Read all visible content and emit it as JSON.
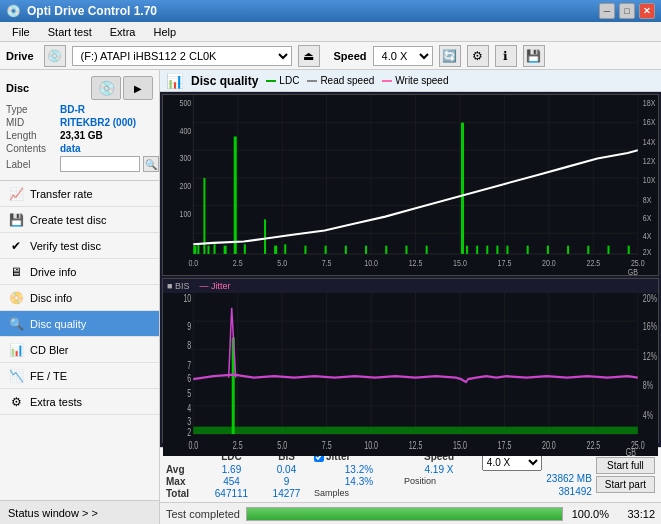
{
  "app": {
    "title": "Opti Drive Control 1.70",
    "icon": "💿"
  },
  "titlebar": {
    "minimize_label": "─",
    "maximize_label": "□",
    "close_label": "✕"
  },
  "menu": {
    "items": [
      "File",
      "Start test",
      "Extra",
      "Help"
    ]
  },
  "drive": {
    "label": "Drive",
    "select_value": "(F:)  ATAPI iHBS112  2 CL0K",
    "speed_label": "Speed",
    "speed_value": "4.0 X"
  },
  "disc": {
    "section_label": "Disc",
    "type_label": "Type",
    "type_value": "BD-R",
    "mid_label": "MID",
    "mid_value": "RITEKBR2 (000)",
    "length_label": "Length",
    "length_value": "23,31 GB",
    "contents_label": "Contents",
    "contents_value": "data",
    "label_label": "Label",
    "label_placeholder": ""
  },
  "nav": {
    "items": [
      {
        "id": "transfer-rate",
        "label": "Transfer rate",
        "icon": "📈"
      },
      {
        "id": "create-test-disc",
        "label": "Create test disc",
        "icon": "💾"
      },
      {
        "id": "verify-test-disc",
        "label": "Verify test disc",
        "icon": "✔"
      },
      {
        "id": "drive-info",
        "label": "Drive info",
        "icon": "🖥"
      },
      {
        "id": "disc-info",
        "label": "Disc info",
        "icon": "📀"
      },
      {
        "id": "disc-quality",
        "label": "Disc quality",
        "icon": "🔍",
        "active": true
      },
      {
        "id": "cd-bler",
        "label": "CD Bler",
        "icon": "📊"
      },
      {
        "id": "fe-te",
        "label": "FE / TE",
        "icon": "📉"
      },
      {
        "id": "extra-tests",
        "label": "Extra tests",
        "icon": "⚙"
      }
    ]
  },
  "status_window": {
    "label": "Status window > >"
  },
  "chart": {
    "title": "Disc quality",
    "legend": {
      "ldc_label": "LDC",
      "read_label": "Read speed",
      "write_label": "Write speed",
      "bis_label": "BIS",
      "jitter_label": "Jitter"
    },
    "top_chart": {
      "y_max": 500,
      "x_max": 25,
      "y_right_labels": [
        "18X",
        "16X",
        "14X",
        "12X",
        "10X",
        "8X",
        "6X",
        "4X",
        "2X"
      ],
      "x_labels": [
        "0.0",
        "2.5",
        "5.0",
        "7.5",
        "10.0",
        "12.5",
        "15.0",
        "17.5",
        "20.0",
        "22.5",
        "25.0"
      ]
    },
    "bottom_chart": {
      "y_max": 10,
      "x_max": 25,
      "y_right_labels": [
        "20%",
        "16%",
        "12%",
        "8%",
        "4%"
      ],
      "x_labels": [
        "0.0",
        "2.5",
        "5.0",
        "7.5",
        "10.0",
        "12.5",
        "15.0",
        "17.5",
        "20.0",
        "22.5",
        "25.0"
      ]
    }
  },
  "stats": {
    "headers": [
      "",
      "LDC",
      "BIS",
      "",
      "Jitter",
      "Speed",
      ""
    ],
    "rows": [
      {
        "label": "Avg",
        "ldc": "1.69",
        "bis": "0.04",
        "jitter": "13.2%",
        "speed": "4.19 X"
      },
      {
        "label": "Max",
        "ldc": "454",
        "bis": "9",
        "jitter": "14.3%",
        "position": "23862 MB"
      },
      {
        "label": "Total",
        "ldc": "647111",
        "bis": "14277",
        "samples": "381492"
      }
    ],
    "speed_select": "4.0 X",
    "start_full_label": "Start full",
    "start_part_label": "Start part",
    "jitter_checked": true,
    "jitter_label": "Jitter"
  },
  "progress": {
    "status_label": "Test completed",
    "percent": 100,
    "percent_text": "100.0%",
    "time_text": "33:12"
  }
}
